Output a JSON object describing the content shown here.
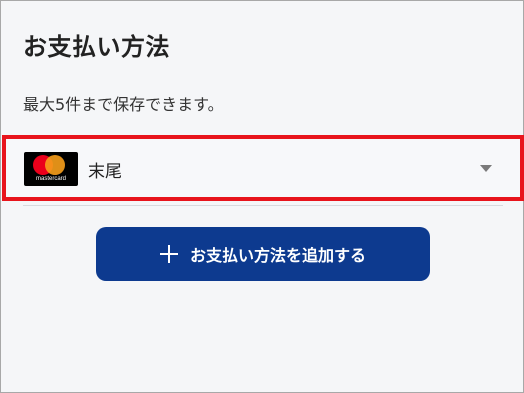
{
  "page": {
    "title": "お支払い方法",
    "note": "最大5件まで保存できます。"
  },
  "card_select": {
    "label": "末尾",
    "brand_icon": "mastercard-logo",
    "brand_text": "mastercard",
    "highlight_color": "#e8141c"
  },
  "add_button": {
    "label": "お支払い方法を追加する",
    "icon": "plus-icon",
    "color": "#0d3a8f"
  }
}
